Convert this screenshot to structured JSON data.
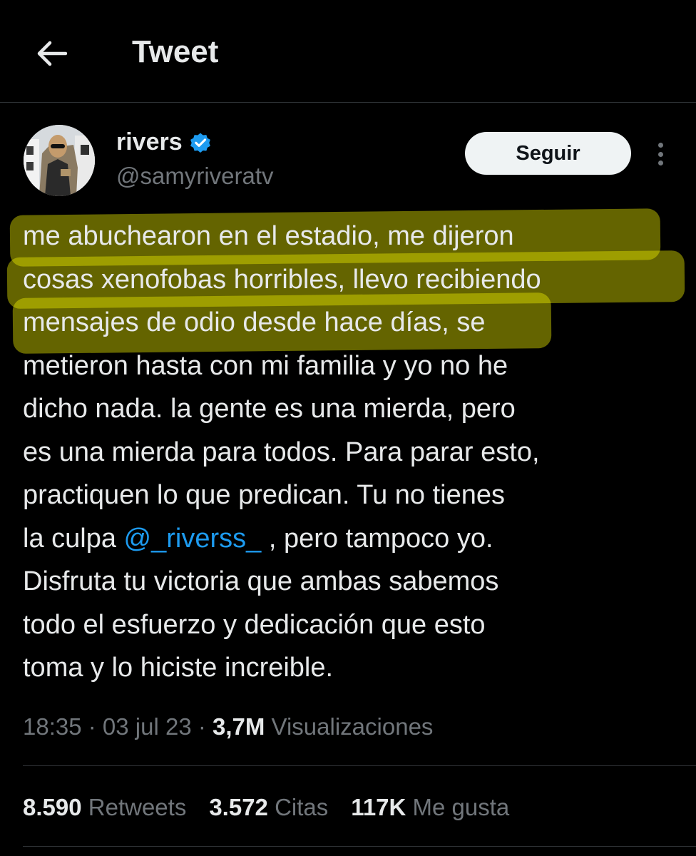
{
  "header": {
    "title": "Tweet",
    "back_icon": "arrow-left-icon"
  },
  "author": {
    "display_name": "rivers",
    "handle": "@samyriveratv",
    "verified": true,
    "verified_color": "#1d9bf0"
  },
  "follow_button": {
    "label": "Seguir"
  },
  "tweet": {
    "lines": [
      "me abuchearon en el estadio, me dijeron",
      "cosas xenofobas horribles, llevo recibiendo",
      "mensajes de odio desde hace días, se",
      "metieron hasta con mi familia y yo no he",
      "dicho nada. la gente es una mierda, pero",
      "es una mierda para todos. Para parar esto,",
      "practiquen lo que predican. Tu no tienes"
    ],
    "line8_before": "la culpa ",
    "mention": "@_riverss_",
    "line8_after": " , pero tampoco yo.",
    "lines_end": [
      "Disfruta tu victoria que ambas sabemos",
      "todo el esfuerzo y dedicación que esto",
      "toma y lo hiciste increible."
    ],
    "highlight_color": "#eeee00"
  },
  "meta": {
    "time": "18:35",
    "separator": " · ",
    "date": "03 jul 23",
    "views_count": "3,7M",
    "views_label": " Visualizaciones"
  },
  "stats": {
    "retweets_count": "8.590",
    "retweets_label": " Retweets",
    "quotes_count": "3.572",
    "quotes_label": " Citas",
    "likes_count": "117K",
    "likes_label": " Me gusta"
  },
  "colors": {
    "background": "#000000",
    "text": "#e7e9ea",
    "secondary": "#71767b",
    "link": "#1d9bf0",
    "border": "#2f3336"
  }
}
